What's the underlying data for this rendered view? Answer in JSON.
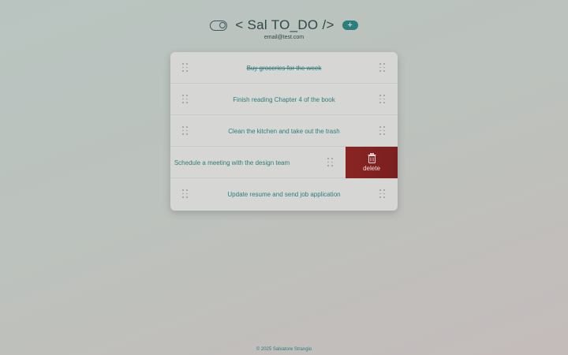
{
  "header": {
    "title": "< Sal TO_DO />",
    "add_label": "+",
    "email": "email@test.com"
  },
  "todos": [
    {
      "text": "Buy groceries for the week",
      "done": true
    },
    {
      "text": "Finish reading Chapter 4 of the book",
      "done": false
    },
    {
      "text": "Clean the kitchen and take out the trash",
      "done": false
    },
    {
      "text": "Schedule a meeting with the design team",
      "done": false
    },
    {
      "text": "Update resume and send job application",
      "done": false
    }
  ],
  "delete_label": "delete",
  "footer": "© 2025 Salvatore Strangio",
  "colors": {
    "accent": "#2f7d7a",
    "danger": "#8a2424"
  }
}
